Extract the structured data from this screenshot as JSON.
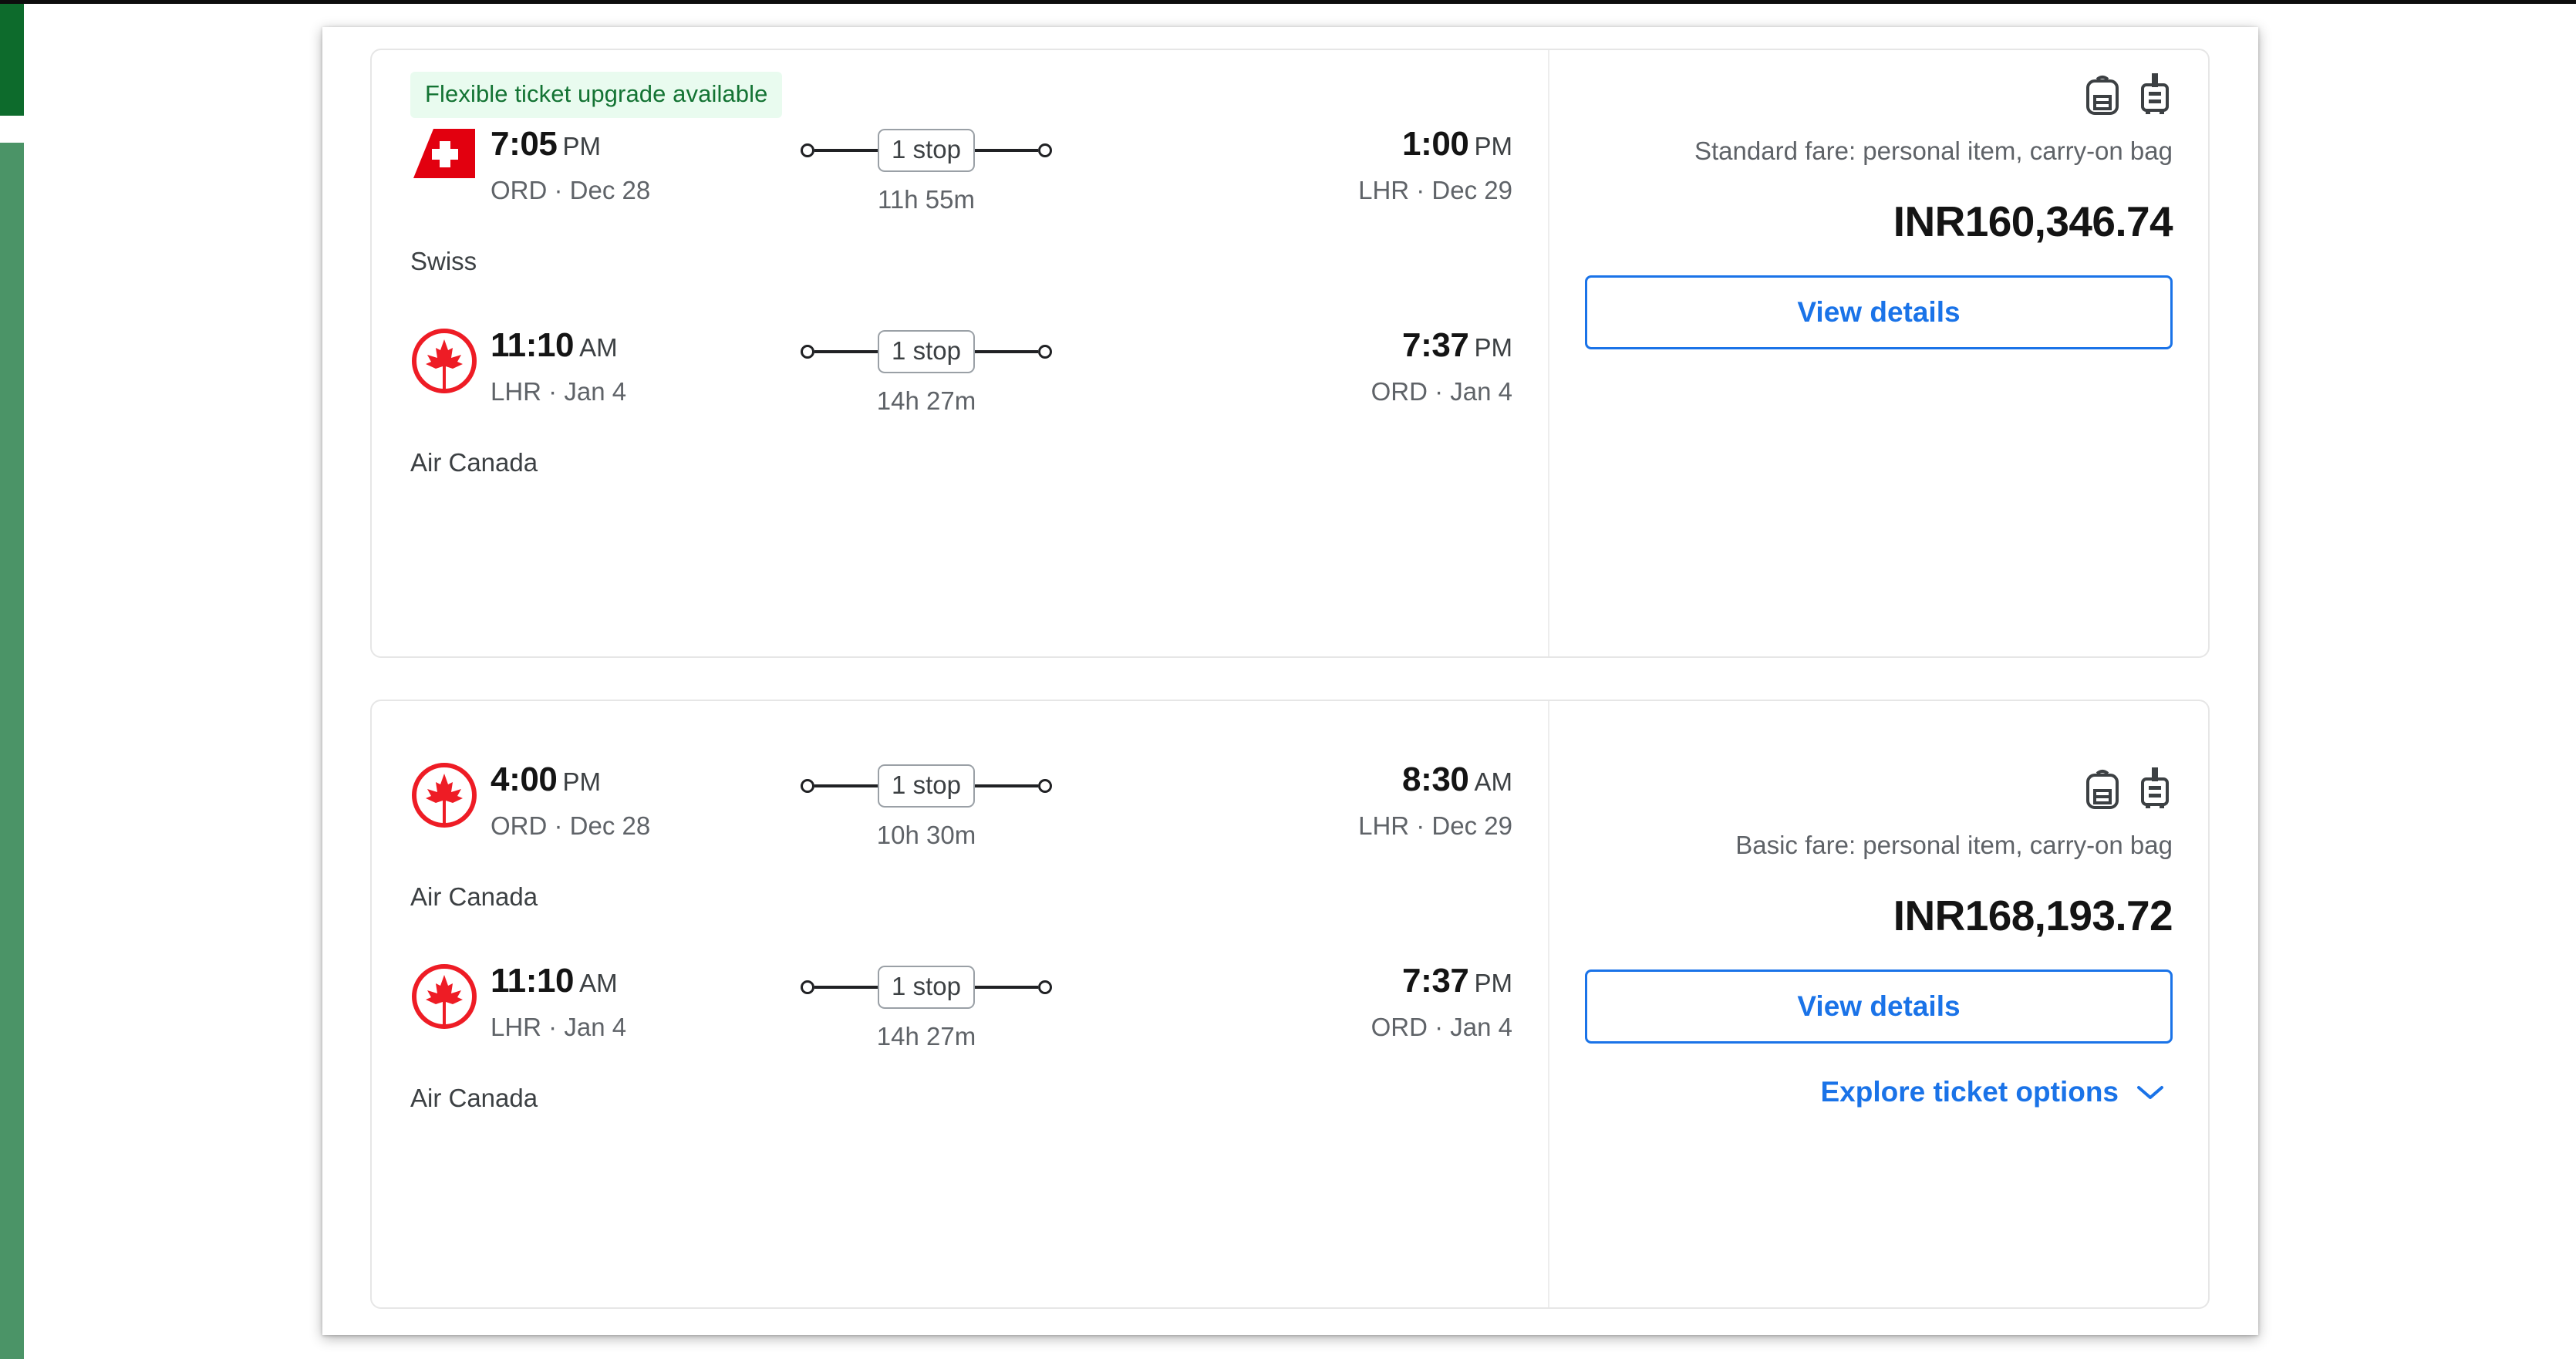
{
  "colors": {
    "accent_blue": "#1a73e8",
    "badge_bg": "#e9fbef",
    "badge_text": "#137333",
    "rail_dark_green": "#0d6b2c",
    "rail_light_green": "#4b9467",
    "price_text": "#141414",
    "muted_text": "#5f6368",
    "air_canada_red": "#ee1c25",
    "swiss_red": "#e2000f"
  },
  "cards": [
    {
      "badge": "Flexible ticket upgrade available",
      "legs": [
        {
          "airline": "Swiss",
          "logo": "swiss-tailfin-logo",
          "depart_time": "7:05",
          "depart_ampm": "PM",
          "depart_place": "ORD · Dec 28",
          "stops": "1 stop",
          "duration": "11h 55m",
          "arrive_time": "1:00",
          "arrive_ampm": "PM",
          "arrive_place": "LHR · Dec 29"
        },
        {
          "airline": "Air Canada",
          "logo": "air-canada-roundel-logo",
          "depart_time": "11:10",
          "depart_ampm": "AM",
          "depart_place": "LHR · Jan 4",
          "stops": "1 stop",
          "duration": "14h 27m",
          "arrive_time": "7:37",
          "arrive_ampm": "PM",
          "arrive_place": "ORD · Jan 4"
        }
      ],
      "fare_text": "Standard fare: personal item, carry-on bag",
      "price": "INR160,346.74",
      "view_details_label": "View details",
      "explore_label": null
    },
    {
      "badge": null,
      "legs": [
        {
          "airline": "Air Canada",
          "logo": "air-canada-roundel-logo",
          "depart_time": "4:00",
          "depart_ampm": "PM",
          "depart_place": "ORD · Dec 28",
          "stops": "1 stop",
          "duration": "10h 30m",
          "arrive_time": "8:30",
          "arrive_ampm": "AM",
          "arrive_place": "LHR · Dec 29"
        },
        {
          "airline": "Air Canada",
          "logo": "air-canada-roundel-logo",
          "depart_time": "11:10",
          "depart_ampm": "AM",
          "depart_place": "LHR · Jan 4",
          "stops": "1 stop",
          "duration": "14h 27m",
          "arrive_time": "7:37",
          "arrive_ampm": "PM",
          "arrive_place": "ORD · Jan 4"
        }
      ],
      "fare_text": "Basic fare: personal item, carry-on bag",
      "price": "INR168,193.72",
      "view_details_label": "View details",
      "explore_label": "Explore ticket options"
    }
  ],
  "icons": {
    "personal_item": "backpack-icon",
    "carry_on": "rolling-suitcase-icon",
    "expand": "chevron-down-icon"
  }
}
